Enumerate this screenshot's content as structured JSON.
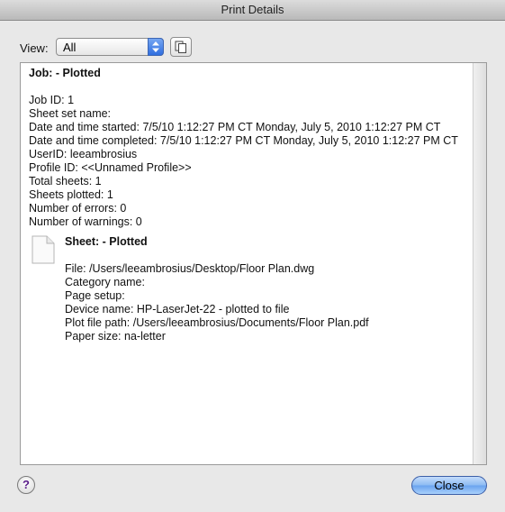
{
  "window": {
    "title": "Print Details"
  },
  "toolbar": {
    "view_label": "View:",
    "view_value": "All"
  },
  "job": {
    "heading": "Job: - Plotted",
    "lines": [
      "Job ID: 1",
      "Sheet set name:",
      "Date and time started: 7/5/10 1:12:27 PM CT Monday, July 5, 2010 1:12:27 PM CT",
      "Date and time completed: 7/5/10 1:12:27 PM CT Monday, July 5, 2010 1:12:27 PM CT",
      "UserID: leeambrosius",
      "Profile ID: <<Unnamed Profile>>",
      "Total sheets: 1",
      "Sheets plotted: 1",
      "Number of errors: 0",
      "Number of warnings: 0"
    ]
  },
  "sheet": {
    "heading": "Sheet: - Plotted",
    "lines": [
      "File: /Users/leeambrosius/Desktop/Floor Plan.dwg",
      "Category name:",
      "Page setup:",
      "Device name: HP-LaserJet-22 - plotted to file",
      "Plot file path: /Users/leeambrosius/Documents/Floor Plan.pdf",
      "Paper size: na-letter"
    ]
  },
  "footer": {
    "help_label": "?",
    "close_label": "Close"
  }
}
